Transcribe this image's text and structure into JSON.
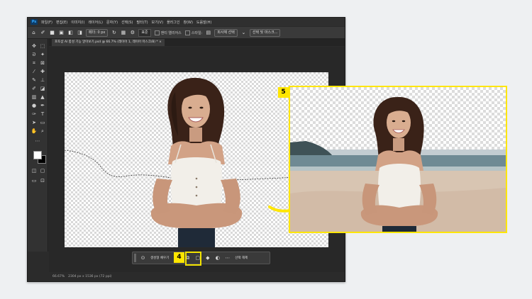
{
  "app": {
    "logo_text": "Ps",
    "menu": [
      "파일(F)",
      "편집(E)",
      "이미지(I)",
      "레이어(L)",
      "문자(Y)",
      "선택(S)",
      "필터(T)",
      "보기(V)",
      "플러그인",
      "창(W)",
      "도움말(H)"
    ]
  },
  "options_bar": {
    "feather_label": "페더: 0 px",
    "antialias_label": "앤티 앨리어스",
    "style_label": "스타일:",
    "style_value": "표준",
    "select_subject": "피사체 선택",
    "select_and_mask": "선택 및 마스크..."
  },
  "document": {
    "tab_title": "포토샵 AI 합성 기능 알아보기.psd @ 66.7% (레이어 1, 레이어 마스크/8) *"
  },
  "status": {
    "zoom": "66.67%",
    "doc_size": "2304 px x 1536 px (72 ppi)"
  },
  "context_bar": {
    "generate_label": "생성형 채우기",
    "deselect_label": "선택 해제"
  },
  "callouts": {
    "step4": "4",
    "step5": "5"
  },
  "colors": {
    "highlight": "#ffe600",
    "ui_dark": "#2b2b2b",
    "page_bg": "#eef0f2"
  },
  "icons": {
    "tools": [
      "move",
      "marquee",
      "lasso",
      "magic-wand",
      "crop",
      "frame",
      "eyedropper",
      "healing",
      "brush",
      "clone-stamp",
      "history-brush",
      "eraser",
      "gradient",
      "blur",
      "dodge",
      "pen",
      "type",
      "path-select",
      "rectangle",
      "hand",
      "zoom",
      "more"
    ],
    "context": [
      "options-icon",
      "generative-fill-icon",
      "mask-icon",
      "paint-icon",
      "contrast-icon",
      "more-icon"
    ]
  }
}
